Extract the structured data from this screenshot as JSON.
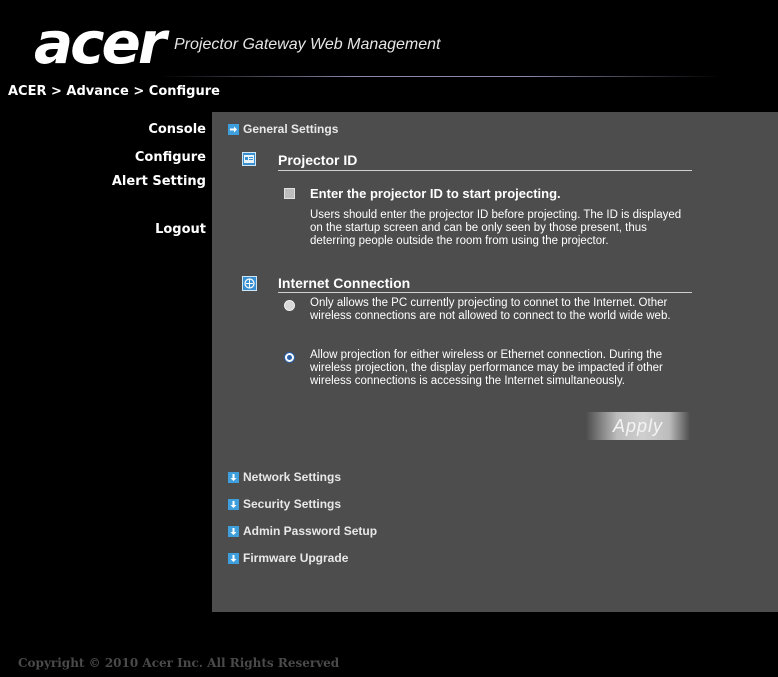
{
  "header": {
    "logo": "acer",
    "title": "Projector Gateway Web Management"
  },
  "breadcrumb": "ACER > Advance > Configure",
  "sidebar": {
    "items": [
      {
        "label": "Console"
      },
      {
        "label": "Configure"
      },
      {
        "label": "Alert Setting"
      },
      {
        "label": "Logout"
      }
    ]
  },
  "main": {
    "general_settings": {
      "label": "General Settings",
      "expanded": true,
      "projector_id": {
        "title": "Projector ID",
        "option_label": "Enter the projector ID to start projecting.",
        "checked": false,
        "description": "Users should enter the projector ID before projecting. The ID is displayed on the startup screen and can be only seen by those present, thus deterring people outside the room from using the projector."
      },
      "internet_connection": {
        "title": "Internet Connection",
        "options": [
          {
            "text": "Only allows the PC currently projecting to connet to the Internet. Other wireless connections are not allowed to connect to the world wide web.",
            "selected": false
          },
          {
            "text": "Allow projection for either wireless or Ethernet connection. During the wireless projection, the display performance may be impacted if other wireless connections is accessing the Internet simultaneously.",
            "selected": true
          }
        ]
      },
      "apply_label": "Apply"
    },
    "collapsed_sections": [
      {
        "label": "Network Settings"
      },
      {
        "label": "Security Settings"
      },
      {
        "label": "Admin Password Setup"
      },
      {
        "label": "Firmware Upgrade"
      }
    ]
  },
  "footer": "Copyright © 2010 Acer Inc. All Rights Reserved",
  "colors": {
    "panel_bg": "#4d4d4d",
    "arrow_icon": "#3f9fdc",
    "page_bg": "#000000"
  },
  "icons": {
    "section_expanded": "arrow-right-icon",
    "section_collapsed": "arrow-down-icon",
    "projector_id": "id-card-icon",
    "internet_connection": "globe-icon"
  }
}
